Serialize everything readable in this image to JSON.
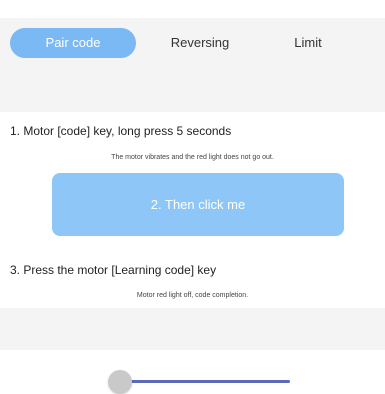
{
  "tabs": [
    {
      "label": "Pair code",
      "active": true
    },
    {
      "label": "Reversing",
      "active": false
    },
    {
      "label": "Limit",
      "active": false
    }
  ],
  "steps": {
    "step1_title": "1. Motor [code] key, long press 5 seconds",
    "step1_note": "The motor vibrates and the red light does not go out.",
    "step2_button": "2. Then click me",
    "step3_title": "3. Press the motor [Learning code] key",
    "step3_note": "Motor red light off, code completion."
  },
  "slider": {
    "value_fraction": 0.0
  },
  "colors": {
    "accent": "#7ab9f3",
    "button": "#8ec7f7",
    "slider_track": "#5c6ab8",
    "band": "#f4f4f4"
  }
}
